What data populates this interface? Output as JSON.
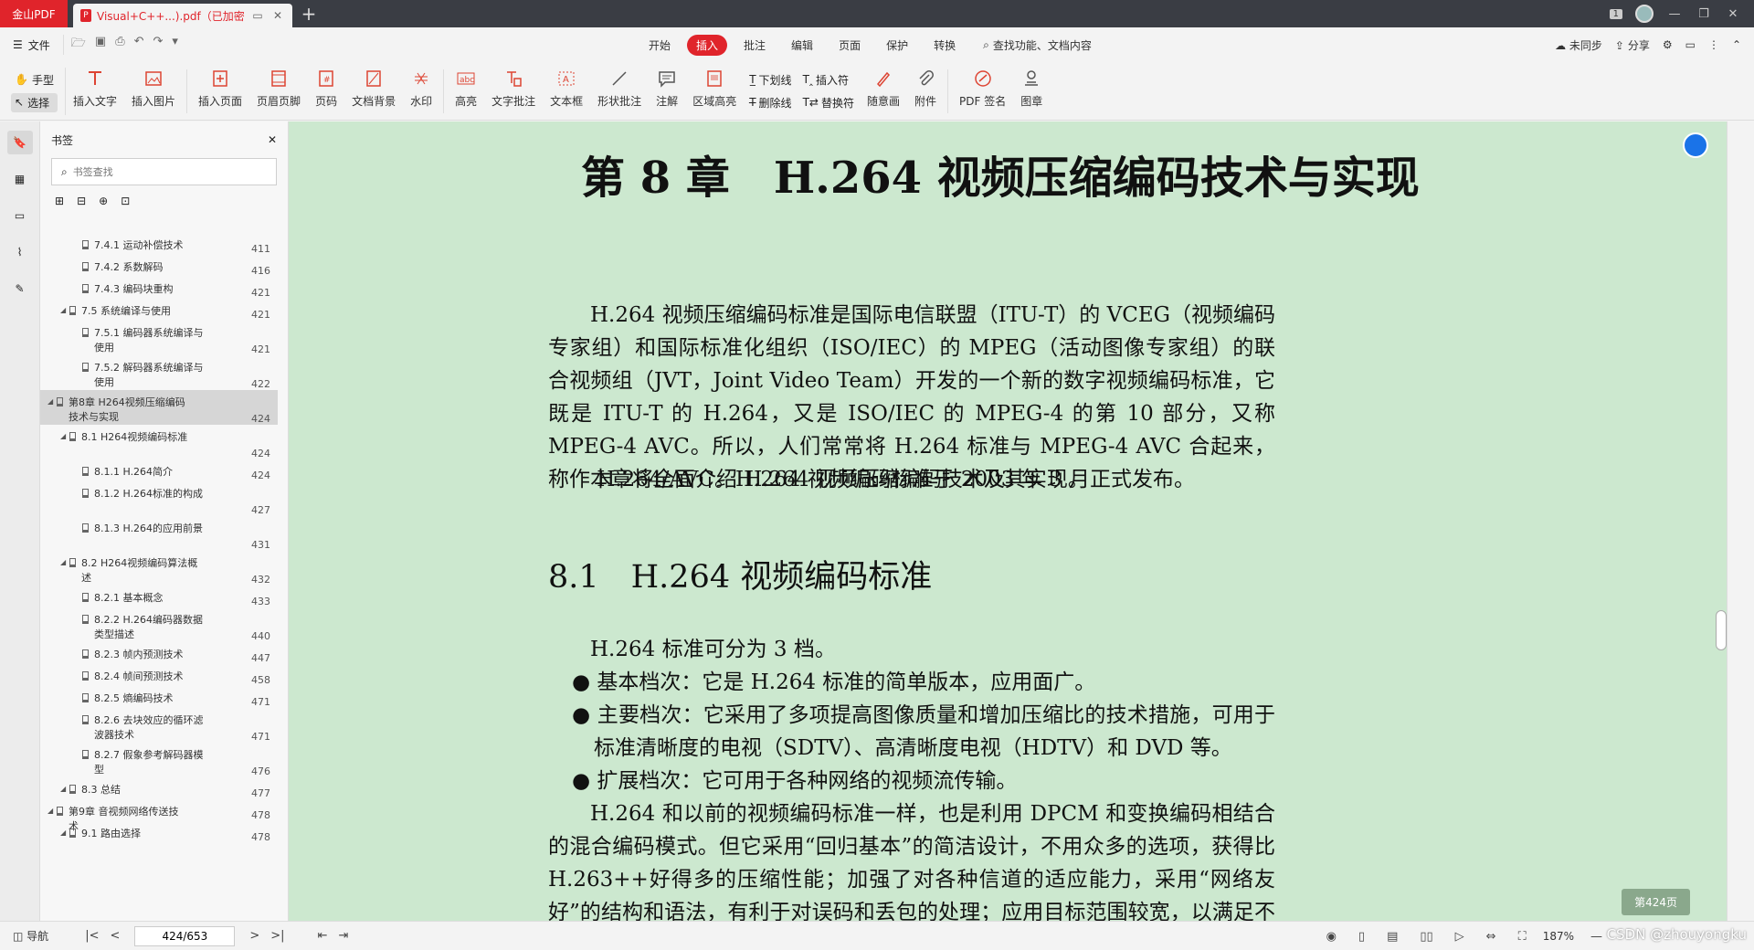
{
  "titlebar": {
    "app_name": "金山PDF",
    "doc_tab_label": "Visual+C++...).pdf（已加密）",
    "page_badge": "1"
  },
  "menubar": {
    "file_label": "文件",
    "tabs": [
      {
        "label": "开始"
      },
      {
        "label": "插入"
      },
      {
        "label": "批注"
      },
      {
        "label": "编辑"
      },
      {
        "label": "页面"
      },
      {
        "label": "保护"
      },
      {
        "label": "转换"
      }
    ],
    "search_label": "查找功能、文档内容",
    "sync_label": "未同步",
    "share_label": "分享"
  },
  "ribbon": {
    "hand_label": "手型",
    "select_label": "选择",
    "buttons": [
      {
        "label": "插入文字"
      },
      {
        "label": "插入图片"
      },
      {
        "label": "插入页面"
      },
      {
        "label": "页眉页脚"
      },
      {
        "label": "页码"
      },
      {
        "label": "文档背景"
      },
      {
        "label": "水印"
      },
      {
        "label": "高亮"
      },
      {
        "label": "文字批注"
      },
      {
        "label": "文本框"
      },
      {
        "label": "形状批注"
      },
      {
        "label": "注解"
      },
      {
        "label": "区域高亮"
      }
    ],
    "underline_label": "下划线",
    "strike_label": "删除线",
    "insert_sym_label": "插入符",
    "replace_sym_label": "替换符",
    "buttons2": [
      {
        "label": "随意画"
      },
      {
        "label": "附件"
      },
      {
        "label": "PDF 签名"
      },
      {
        "label": "图章"
      }
    ]
  },
  "bookmarks": {
    "title": "书签",
    "search_placeholder": "书签查找",
    "items": [
      {
        "title": "7.4.1 运动补偿技术",
        "page": "411",
        "level": 2
      },
      {
        "title": "7.4.2 系数解码",
        "page": "416",
        "level": 2
      },
      {
        "title": "7.4.3 编码块重构",
        "page": "421",
        "level": 2
      },
      {
        "title": "7.5 系统编译与使用",
        "page": "421",
        "level": 1
      },
      {
        "title": "7.5.1 编码器系统编译与使用",
        "page": "421",
        "level": 2
      },
      {
        "title": "7.5.2 解码器系统编译与使用",
        "page": "422",
        "level": 2
      },
      {
        "title": "第8章 H264视频压缩编码技术与实现",
        "page": "424",
        "level": 0,
        "selected": true
      },
      {
        "title": "8.1 H264视频编码标准",
        "page": "424",
        "level": 1
      },
      {
        "title": "8.1.1 H.264简介",
        "page": "424",
        "level": 2
      },
      {
        "title": "8.1.2 H.264标准的构成",
        "page": "427",
        "level": 2
      },
      {
        "title": "8.1.3 H.264的应用前景",
        "page": "431",
        "level": 2
      },
      {
        "title": "8.2 H264视频编码算法概述",
        "page": "432",
        "level": 1
      },
      {
        "title": "8.2.1 基本概念",
        "page": "433",
        "level": 2
      },
      {
        "title": "8.2.2 H.264编码器数据类型描述",
        "page": "440",
        "level": 2
      },
      {
        "title": "8.2.3 帧内预测技术",
        "page": "447",
        "level": 2
      },
      {
        "title": "8.2.4 帧间预测技术",
        "page": "458",
        "level": 2
      },
      {
        "title": "8.2.5 熵编码技术",
        "page": "471",
        "level": 2
      },
      {
        "title": "8.2.6 去块效应的循环滤波器技术",
        "page": "471",
        "level": 2
      },
      {
        "title": "8.2.7 假象参考解码器模型",
        "page": "476",
        "level": 2
      },
      {
        "title": "8.3 总结",
        "page": "477",
        "level": 1
      },
      {
        "title": "第9章 音视频网络传送技术",
        "page": "478",
        "level": 0
      },
      {
        "title": "9.1 路由选择",
        "page": "478",
        "level": 1
      }
    ]
  },
  "document": {
    "chapter_title": "第 8 章　H.264 视频压缩编码技术与实现",
    "intro_paragraph": "H.264 视频压缩编码标准是国际电信联盟（ITU-T）的 VCEG（视频编码专家组）和国际标准化组织（ISO/IEC）的 MPEG（活动图像专家组）的联合视频组（JVT，Joint Video Team）开发的一个新的数字视频编码标准，它既是 ITU-T 的 H.264，又是 ISO/IEC 的 MPEG-4 的第 10 部分，又称 MPEG-4 AVC。所以，人们常常将 H.264 标准与 MPEG-4 AVC 合起来，称作 H.264/AVC。H.264 视频编码标准于 2003 年 3 月正式发布。",
    "intro_paragraph2": "本章将全面介绍 H.264 视频压缩编码技术及其实现。",
    "section_title": "8.1　H.264 视频编码标准",
    "profiles_intro": "H.264 标准可分为 3 档。",
    "profiles": [
      "基本档次：它是 H.264 标准的简单版本，应用面广。",
      "主要档次：它采用了多项提高图像质量和增加压缩比的技术措施，可用于标准清晰度的电视（SDTV）、高清晰度电视（HDTV）和 DVD 等。",
      "扩展档次：它可用于各种网络的视频流传输。"
    ],
    "tail_paragraph": "H.264 和以前的视频编码标准一样，也是利用 DPCM 和变换编码相结合的混合编码模式。但它采用“回归基本”的简洁设计，不用众多的选项，获得比 H.263++好得多的压缩性能；加强了对各种信道的适应能力，采用“网络友好”的结构和语法，有利于对误码和丢包的处理；应用目标范围较宽，以满足不同速率、不同解析度以及不同传输（存储）场合的需求；",
    "page_badge": "第424页"
  },
  "statusbar": {
    "nav_label": "导航",
    "page_input": "424/653",
    "zoom": "187%",
    "watermark": "CSDN @zhouyongku"
  }
}
